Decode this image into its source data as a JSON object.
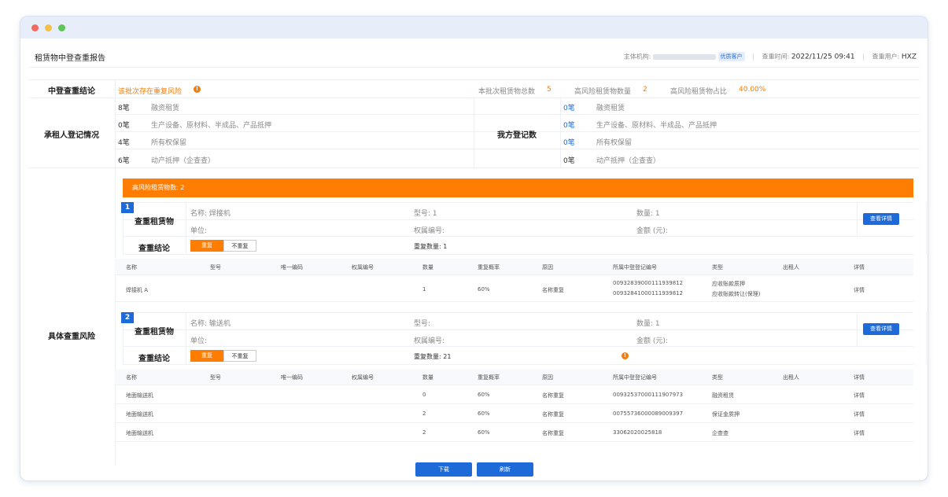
{
  "report": {
    "title": "租赁物中登查重报告",
    "org_label": "主体机构:",
    "org_tag": "优质客户",
    "time_label": "查重时间:",
    "time_value": "2022/11/25 09:41",
    "user_label": "查重用户:",
    "user_value": "HXZ"
  },
  "conclusion": {
    "label": "中登查重结论",
    "text": "该批次存在重复风险",
    "total_label": "本批次租赁物总数",
    "total_value": "5",
    "high_label": "高风险租赁物数量",
    "high_value": "2",
    "ratio_label": "高风险租赁物占比",
    "ratio_value": "40.00%"
  },
  "lessee": {
    "label": "承租人登记情况",
    "rows": [
      {
        "count": "8笔",
        "type": "融资租赁"
      },
      {
        "count": "0笔",
        "type": "生产设备、原材料、半成品、产品抵押"
      },
      {
        "count": "4笔",
        "type": "所有权保留"
      },
      {
        "count": "6笔",
        "type": "动产抵押（企查查）"
      }
    ]
  },
  "ours": {
    "label": "我方登记数",
    "rows": [
      {
        "count": "0笔",
        "type": "融资租赁"
      },
      {
        "count": "0笔",
        "type": "生产设备、原材料、半成品、产品抵押"
      },
      {
        "count": "0笔",
        "type": "所有权保留"
      },
      {
        "count": "0笔",
        "type": "动产抵押（企查查）"
      }
    ]
  },
  "risk": {
    "label": "具体查重风险",
    "banner": "高风险租赁物数: 2",
    "items": [
      {
        "index": "1",
        "asset_label": "查重租赁物",
        "name": "名称: 焊接机",
        "model": "型号: 1",
        "qty": "数量: 1",
        "unit": "单位:",
        "ownership": "权属编号:",
        "amount": "金额 (元):",
        "detail_btn": "查看详情",
        "result_label": "查重结论",
        "seg_on": "重复",
        "seg_off": "不重复",
        "dup_count": "重复数量: 1",
        "headers": [
          "名称",
          "型号",
          "唯一编码",
          "权属编号",
          "数量",
          "重复概率",
          "原因",
          "所属中登登记编号",
          "类型",
          "出租人",
          "详情"
        ],
        "rows": [
          {
            "name": "焊接机 A",
            "model": "",
            "code": "",
            "own": "",
            "qty": "1",
            "prob": "60%",
            "reason": "名称重复",
            "reg1": "00932839000111939812",
            "reg2": "00932841000111939812",
            "type1": "应收账款质押",
            "type2": "应收账款转让(保理)",
            "lessor": "",
            "detail": "详情"
          }
        ]
      },
      {
        "index": "2",
        "asset_label": "查重租赁物",
        "name": "名称: 输送机",
        "model": "型号:",
        "qty": "数量: 1",
        "unit": "单位:",
        "ownership": "权属编号:",
        "amount": "金额 (元):",
        "detail_btn": "查看详情",
        "result_label": "查重结论",
        "seg_on": "重复",
        "seg_off": "不重复",
        "dup_count": "重复数量: 21",
        "headers": [
          "名称",
          "型号",
          "唯一编码",
          "权属编号",
          "数量",
          "重复概率",
          "原因",
          "所属中登登记编号",
          "类型",
          "出租人",
          "详情"
        ],
        "rows": [
          {
            "name": "地面输送机",
            "model": "",
            "code": "",
            "own": "",
            "qty": "0",
            "prob": "60%",
            "reason": "名称重复",
            "reg1": "00932537000111907973",
            "reg2": "",
            "type1": "融资租赁",
            "type2": "",
            "lessor": "",
            "detail": "详情"
          },
          {
            "name": "地面输送机",
            "model": "",
            "code": "",
            "own": "",
            "qty": "2",
            "prob": "60%",
            "reason": "名称重复",
            "reg1": "00755736000089009397",
            "reg2": "",
            "type1": "保证金质押",
            "type2": "",
            "lessor": "",
            "detail": "详情"
          },
          {
            "name": "地面输送机",
            "model": "",
            "code": "",
            "own": "",
            "qty": "2",
            "prob": "60%",
            "reason": "名称重复",
            "reg1": "33062020025818",
            "reg2": "",
            "type1": "企查查",
            "type2": "",
            "lessor": "",
            "detail": "详情"
          }
        ]
      }
    ]
  },
  "footer": {
    "download": "下载",
    "refresh": "刷新"
  }
}
